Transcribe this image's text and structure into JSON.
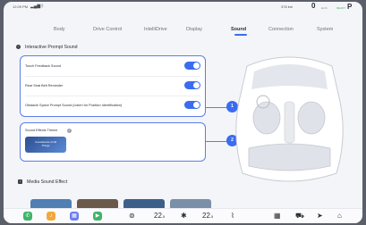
{
  "status": {
    "time": "12:09 PM",
    "range": "378 km",
    "speed": "0",
    "speed_unit": "km/h",
    "ready": "READY",
    "gear": "P"
  },
  "tabs": [
    {
      "label": "Body"
    },
    {
      "label": "Drive Control"
    },
    {
      "label": "IntelliDrive"
    },
    {
      "label": "Display"
    },
    {
      "label": "Sound",
      "active": true
    },
    {
      "label": "Connection"
    },
    {
      "label": "System"
    }
  ],
  "section": {
    "title": "Interactive Prompt Sound"
  },
  "prompt_rows": [
    {
      "label": "Touch Feedback Sound",
      "on": true
    },
    {
      "label": "Rear Seat Belt Reminder",
      "on": true
    },
    {
      "label": "Obstacle Space Prompt Sound (Listen for Position Identification)",
      "on": true
    }
  ],
  "theme": {
    "label": "Sound Effects Theme",
    "tile_line1": "Coexistence of All",
    "tile_line2": "Things"
  },
  "callouts": [
    "1",
    "2"
  ],
  "media": {
    "title": "Media Sound Effect"
  },
  "dock": {
    "temp_left": "22",
    "temp_left_dec": ".5",
    "temp_right": "22",
    "temp_right_dec": ".5"
  },
  "colors": {
    "accent": "#3b6cf0",
    "outline": "#5a7ee8"
  }
}
